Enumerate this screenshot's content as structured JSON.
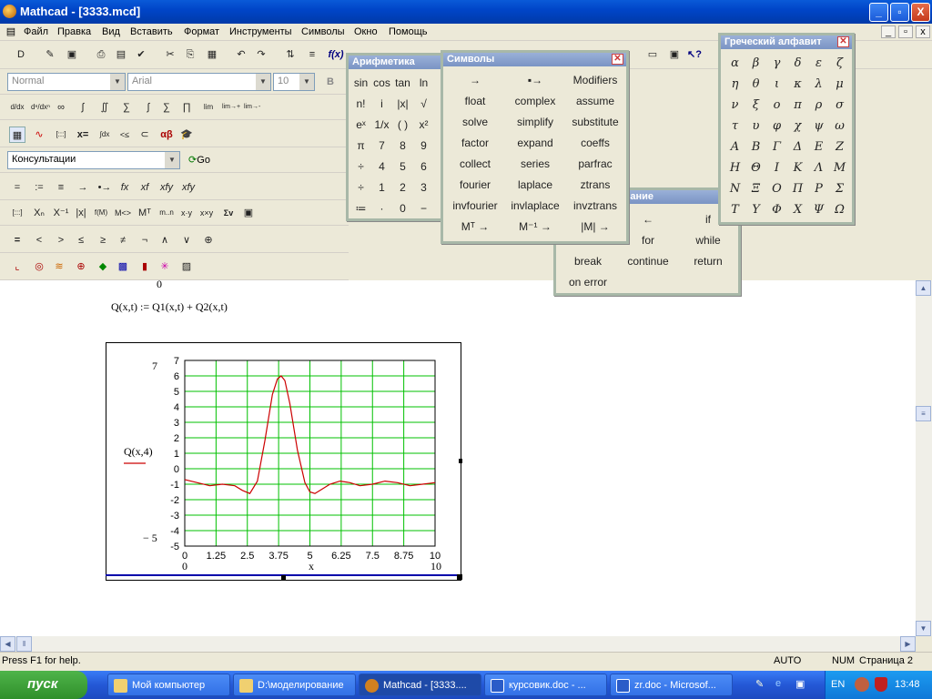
{
  "window": {
    "title": "Mathcad - [3333.mcd]",
    "min": "_",
    "max": "▫",
    "close": "X"
  },
  "menu": [
    "Файл",
    "Правка",
    "Вид",
    "Вставить",
    "Формат",
    "Инструменты",
    "Символы",
    "Окно",
    "Помощь"
  ],
  "format_bar": {
    "style": "Normal",
    "font": "Arial",
    "size": "10"
  },
  "resource_bar": {
    "value": "Консультации",
    "go": "Go"
  },
  "toolbars": {
    "standard": [
      "D",
      "✎",
      "▣",
      "⎙",
      "▤",
      "✔",
      "✂",
      "⎘",
      "▦",
      "↶",
      "↷",
      "⇅",
      "≡",
      "f(x)"
    ],
    "calculus": [
      "d/dx",
      "dⁿ/dxⁿ",
      "∞",
      "∫",
      "∬",
      "∑",
      "∏",
      "lim",
      "lim→+",
      "lim→-"
    ],
    "math": [
      "▦",
      "∿",
      "[:::]",
      "x=",
      "∫dx",
      "<≤",
      "⊂",
      "αβ",
      "🎓"
    ],
    "evaluation": [
      "=",
      ":=",
      "≡",
      "→",
      "•→",
      "fx",
      "xf",
      "xfy",
      "xfy"
    ],
    "matrix": [
      "[:::]",
      "Xₙ",
      "X⁻¹",
      "|x|",
      "f(M)",
      "M<>",
      "Mᵀ",
      "m..n",
      "x·y",
      "x×y",
      "Σv",
      "▣"
    ],
    "boolean": [
      "=",
      "<",
      ">",
      "≤",
      "≥",
      "≠",
      "¬",
      "∧",
      "∨",
      "⊕"
    ],
    "graph": [
      "⌞",
      "◎",
      "≋",
      "⊕",
      "◆",
      "▩",
      "▮",
      "✳",
      "▨"
    ]
  },
  "palettes": {
    "arith": {
      "title": "Арифметика",
      "items": [
        "sin",
        "cos",
        "tan",
        "ln",
        "l",
        "n!",
        "i",
        "|x|",
        "√",
        "",
        "eˣ",
        "1/x",
        "( )",
        "x²",
        "",
        "π",
        "7",
        "8",
        "9",
        "",
        "÷",
        "4",
        "5",
        "6",
        "",
        "÷",
        "1",
        "2",
        "3",
        "+",
        "≔",
        "·",
        "0",
        "−",
        ""
      ]
    },
    "symbols": {
      "title": "Символы",
      "items": [
        "→",
        "▪→",
        "Modifiers",
        "float",
        "complex",
        "assume",
        "solve",
        "simplify",
        "substitute",
        "factor",
        "expand",
        "coeffs",
        "collect",
        "series",
        "parfrac",
        "fourier",
        "laplace",
        "ztrans",
        "invfourier",
        "invlaplace",
        "invztrans",
        "Mᵀ →",
        "M⁻¹ →",
        "|M| →"
      ]
    },
    "prog": {
      "title": "зание",
      "items": [
        "",
        "←",
        "if",
        "",
        "for",
        "while",
        "break",
        "continue",
        "return",
        "on error",
        "",
        ""
      ]
    },
    "greek": {
      "title": "Греческий алфавит",
      "items": [
        "α",
        "β",
        "γ",
        "δ",
        "ε",
        "ζ",
        "η",
        "θ",
        "ι",
        "κ",
        "λ",
        "μ",
        "ν",
        "ξ",
        "ο",
        "π",
        "ρ",
        "σ",
        "τ",
        "υ",
        "φ",
        "χ",
        "ψ",
        "ω",
        "Α",
        "Β",
        "Γ",
        "Δ",
        "Ε",
        "Ζ",
        "Η",
        "Θ",
        "Ι",
        "Κ",
        "Λ",
        "Μ",
        "Ν",
        "Ξ",
        "Ο",
        "Π",
        "Ρ",
        "Σ",
        "Τ",
        "Υ",
        "Φ",
        "Χ",
        "Ψ",
        "Ω"
      ]
    }
  },
  "doc": {
    "top_fragment": "0",
    "equation": "Q(x,t) := Q1(x,t) + Q2(x,t)"
  },
  "chart_data": {
    "type": "line",
    "ylabel": "Q(x,4)",
    "xlabel": "x",
    "xlim": [
      0,
      10
    ],
    "ylim": [
      -5,
      7
    ],
    "ymax_label": "7",
    "ymin_label": "− 5",
    "xmin_label": "0",
    "xmax_label": "10",
    "xticks": [
      "0",
      "1.25",
      "2.5",
      "3.75",
      "5",
      "6.25",
      "7.5",
      "8.75",
      "10"
    ],
    "yticks": [
      "7",
      "6",
      "5",
      "4",
      "3",
      "2",
      "1",
      "0",
      "-1",
      "-2",
      "-3",
      "-4",
      "-5"
    ],
    "grid": true,
    "line_color": "#cc0000",
    "grid_color": "#00c000",
    "series": [
      {
        "x": [
          0,
          0.5,
          1,
          1.5,
          2,
          2.3,
          2.6,
          2.9,
          3.2,
          3.5,
          3.7,
          3.85,
          4,
          4.2,
          4.5,
          4.8,
          5,
          5.2,
          5.5,
          5.8,
          6.2,
          6.6,
          7,
          7.5,
          8,
          8.5,
          9,
          9.5,
          10
        ],
        "values": [
          -0.7,
          -0.9,
          -1.1,
          -1.0,
          -1.1,
          -1.4,
          -1.6,
          -0.8,
          1.8,
          4.8,
          5.8,
          6.0,
          5.7,
          4.2,
          1.2,
          -0.9,
          -1.5,
          -1.6,
          -1.3,
          -1.0,
          -0.8,
          -0.9,
          -1.1,
          -1.0,
          -0.8,
          -0.9,
          -1.1,
          -1.0,
          -0.9
        ]
      }
    ]
  },
  "status": {
    "help": "Press F1 for help.",
    "auto": "AUTO",
    "num": "NUM",
    "page": "Страница 2"
  },
  "taskbar": {
    "start": "пуск",
    "tasks": [
      "Мой компьютер",
      "D:\\моделирование",
      "Mathcad - [3333....",
      "курсовик.doc - ...",
      "zr.doc - Microsof..."
    ],
    "lang": "EN",
    "time": "13:48"
  }
}
